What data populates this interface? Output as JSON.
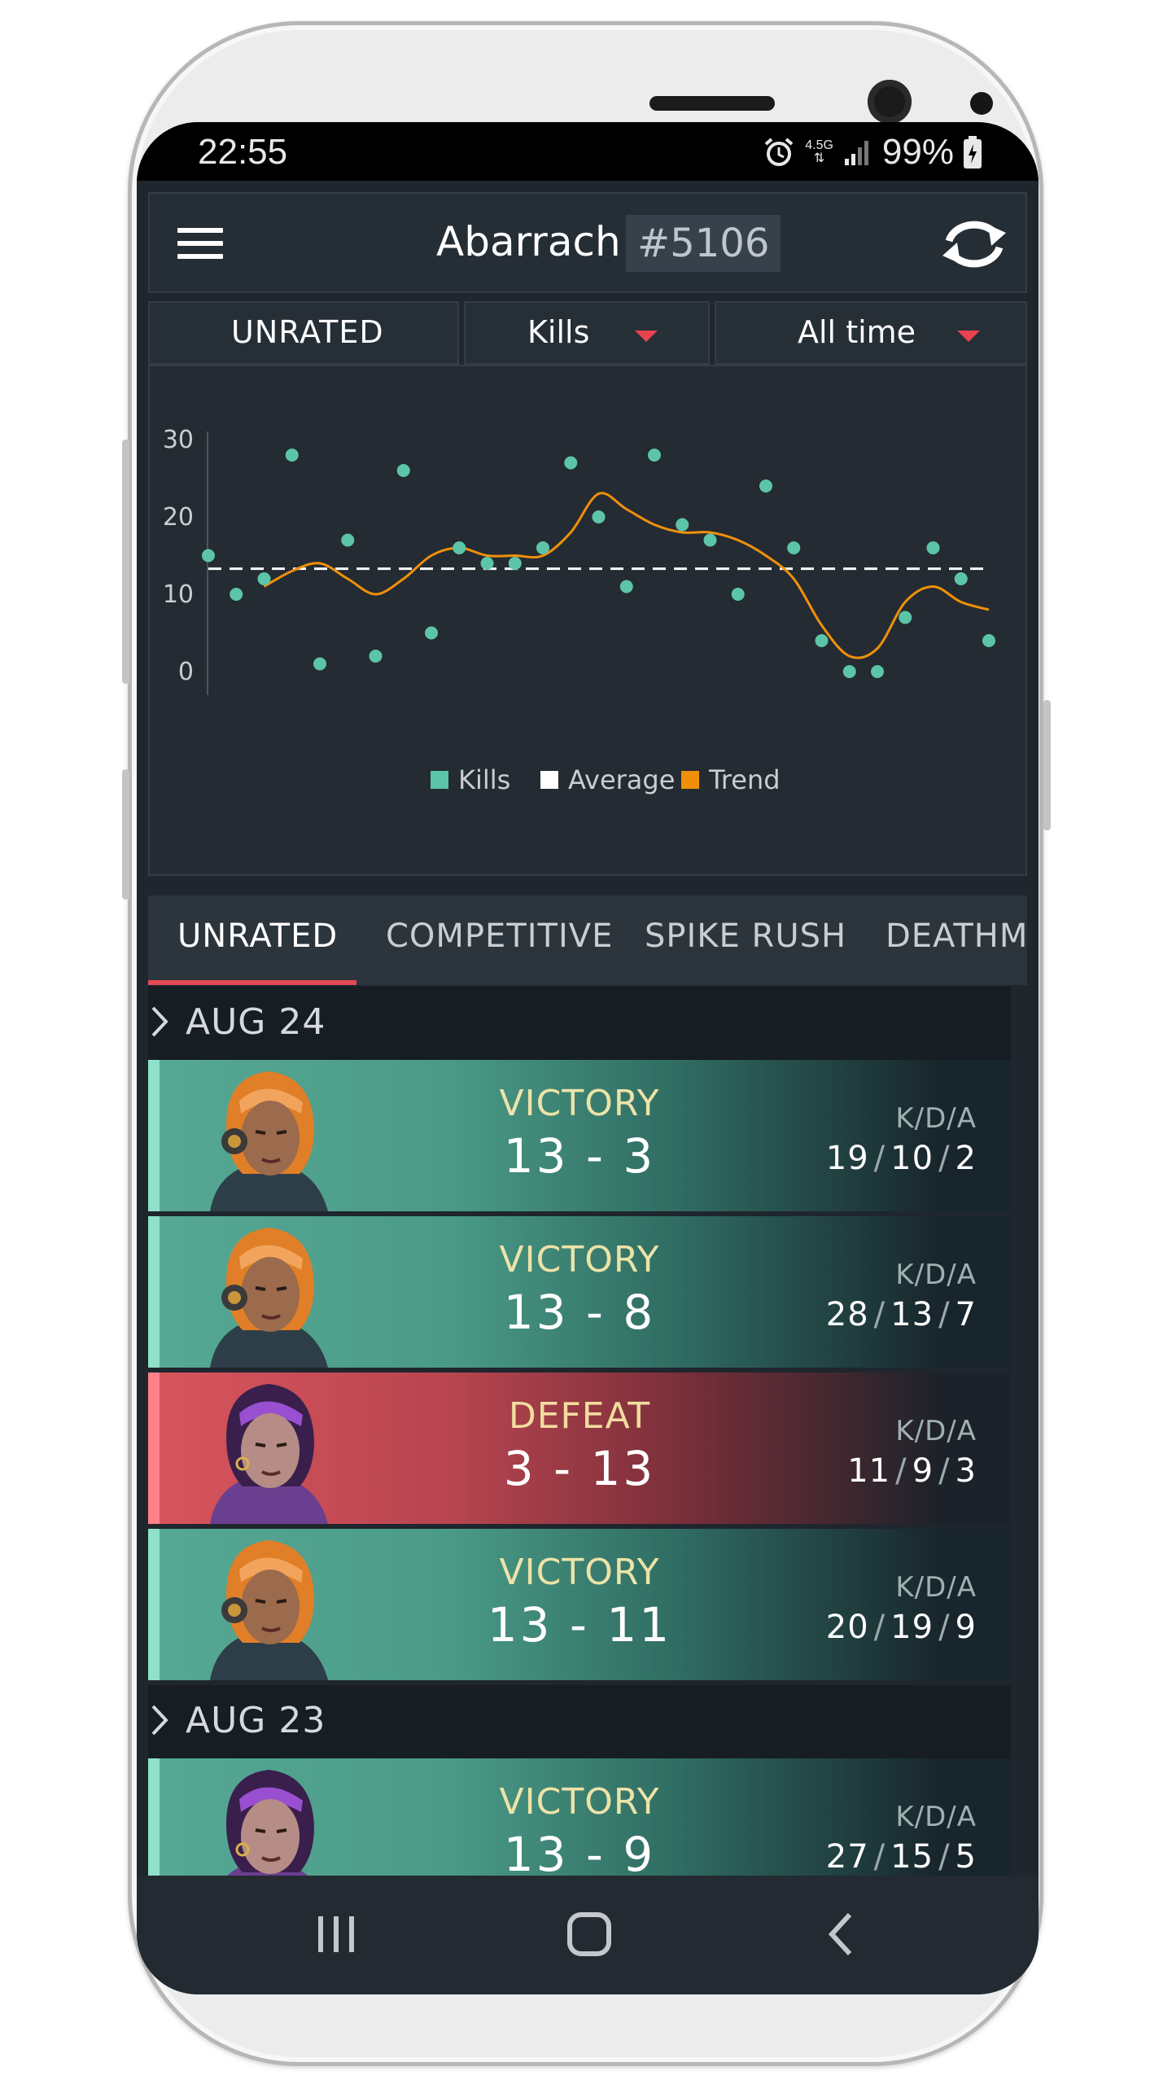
{
  "status_bar": {
    "time": "22:55",
    "network": "4.5G",
    "battery": "99%",
    "icons": [
      "alarm-icon",
      "signal-icon",
      "battery-icon"
    ]
  },
  "header": {
    "player_name": "Abarrach",
    "player_tag": "#5106",
    "icons": [
      "menu-icon",
      "refresh-icon"
    ]
  },
  "filters": {
    "mode": "UNRATED",
    "stat": "Kills",
    "period": "All time",
    "accent": "#e9434f"
  },
  "chart_data": {
    "type": "scatter",
    "y_ticks": [
      "30",
      "20",
      "10",
      "0"
    ],
    "ylim": [
      0,
      30
    ],
    "series": [
      {
        "name": "Kills",
        "color": "#5cc5a8",
        "values": [
          15,
          10,
          12,
          28,
          1,
          17,
          2,
          26,
          5,
          16,
          14,
          14,
          16,
          27,
          20,
          11,
          28,
          19,
          17,
          10,
          24,
          16,
          4,
          0,
          0,
          7,
          16,
          12,
          4
        ]
      },
      {
        "name": "Average",
        "color": "#ffffff",
        "value": 13.3
      },
      {
        "name": "Trend",
        "color": "#f0900a",
        "values": [
          null,
          null,
          11,
          13,
          14,
          12,
          10,
          12,
          15,
          16,
          15,
          15,
          15,
          18,
          23,
          21,
          19,
          18,
          18,
          17,
          15,
          12,
          6,
          2,
          3,
          9,
          11,
          9,
          8
        ]
      }
    ],
    "legend": [
      "Kills",
      "Average",
      "Trend"
    ],
    "legend_placement": "bottom-center",
    "grid": false
  },
  "tabs": [
    {
      "label": "UNRATED",
      "active": true
    },
    {
      "label": "COMPETITIVE",
      "active": false
    },
    {
      "label": "SPIKE RUSH",
      "active": false
    },
    {
      "label": "DEATHMATCH",
      "active": false
    }
  ],
  "groups": [
    {
      "date": "AUG 24",
      "matches": [
        {
          "result": "VICTORY",
          "score": "13 - 3",
          "kda_label": "K/D/A",
          "kills": "19",
          "deaths": "10",
          "assists": "2",
          "agent": "orange-helmet-agent-portrait"
        },
        {
          "result": "VICTORY",
          "score": "13 - 8",
          "kda_label": "K/D/A",
          "kills": "28",
          "deaths": "13",
          "assists": "7",
          "agent": "orange-helmet-agent-portrait"
        },
        {
          "result": "DEFEAT",
          "score": "3 - 13",
          "kda_label": "K/D/A",
          "kills": "11",
          "deaths": "9",
          "assists": "3",
          "agent": "purple-haired-agent-portrait"
        },
        {
          "result": "VICTORY",
          "score": "13 - 11",
          "kda_label": "K/D/A",
          "kills": "20",
          "deaths": "19",
          "assists": "9",
          "agent": "orange-helmet-agent-portrait"
        }
      ]
    },
    {
      "date": "AUG 23",
      "matches": [
        {
          "result": "VICTORY",
          "score": "13 - 9",
          "kda_label": "K/D/A",
          "kills": "27",
          "deaths": "15",
          "assists": "5",
          "agent": "purple-haired-agent-portrait"
        }
      ]
    }
  ],
  "navbar": {
    "icons": [
      "recent-apps-icon",
      "home-icon",
      "back-icon"
    ]
  },
  "colors": {
    "victory": "#56a995",
    "defeat": "#d9555d",
    "tab_underline": "#e34a55"
  }
}
